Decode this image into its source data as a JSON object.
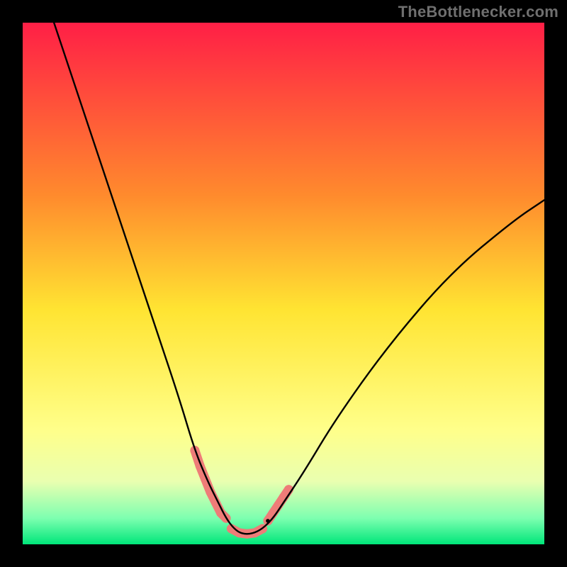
{
  "attribution": "TheBottlenecker.com",
  "chart_data": {
    "type": "line",
    "title": "",
    "xlabel": "",
    "ylabel": "",
    "xlim": [
      0,
      100
    ],
    "ylim": [
      0,
      100
    ],
    "gradient_stops": [
      {
        "offset": 0,
        "color": "#ff1f46"
      },
      {
        "offset": 33,
        "color": "#ff8a2d"
      },
      {
        "offset": 55,
        "color": "#ffe432"
      },
      {
        "offset": 78,
        "color": "#ffff8a"
      },
      {
        "offset": 88,
        "color": "#e9ffb0"
      },
      {
        "offset": 95,
        "color": "#7dffb0"
      },
      {
        "offset": 100,
        "color": "#00e67a"
      }
    ],
    "series": [
      {
        "name": "bottleneck-curve",
        "stroke": "#000000",
        "stroke_width": 2.4,
        "x": [
          6,
          10,
          14,
          18,
          22,
          26,
          30,
          33,
          35.5,
          37.5,
          39,
          40.5,
          42,
          44,
          46,
          48,
          50,
          54,
          60,
          70,
          82,
          94,
          100
        ],
        "y": [
          100,
          88,
          76,
          64,
          52,
          40,
          28,
          18,
          12,
          8,
          5,
          3,
          2,
          2,
          3,
          5,
          8,
          14,
          24,
          38,
          52,
          62,
          66
        ]
      }
    ],
    "highlight_segments": [
      {
        "name": "left-pink-run",
        "color": "#ee7c78",
        "radius": 6.5,
        "points_x": [
          33.0,
          34.0,
          35.0,
          36.0,
          37.0,
          38.0,
          39.0
        ],
        "points_y": [
          18.0,
          15.0,
          12.5,
          10.0,
          8.0,
          6.0,
          5.0
        ]
      },
      {
        "name": "flat-bottom-run",
        "color": "#ee7c78",
        "radius": 6.5,
        "points_x": [
          40.0,
          41.5,
          43.0,
          44.5,
          46.0
        ],
        "points_y": [
          3.0,
          2.2,
          2.0,
          2.2,
          3.0
        ]
      },
      {
        "name": "right-pink-run",
        "color": "#ee7c78",
        "radius": 6.5,
        "points_x": [
          47.0,
          48.0,
          49.0,
          50.0,
          51.0
        ],
        "points_y": [
          4.5,
          6.0,
          7.5,
          9.0,
          10.5
        ]
      }
    ],
    "marker": {
      "name": "selected-point",
      "color": "#000000",
      "radius": 2.8,
      "x": 47.0,
      "y": 4.5
    }
  }
}
